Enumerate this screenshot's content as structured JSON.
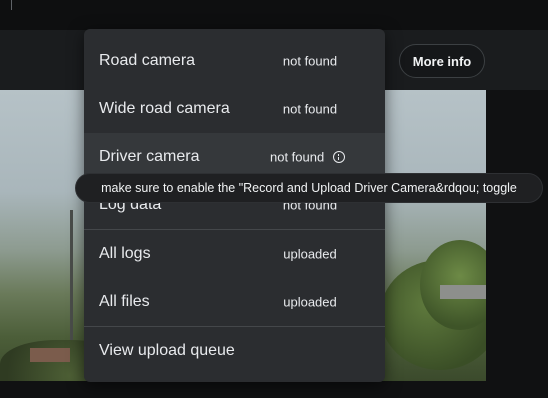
{
  "header": {
    "more_info_label": "More info"
  },
  "menu": {
    "items": [
      {
        "label": "Road camera",
        "status": "not found"
      },
      {
        "label": "Wide road camera",
        "status": "not found"
      },
      {
        "label": "Driver camera",
        "status": "not found",
        "icon": "info-icon"
      },
      {
        "label": "Log data",
        "status": "not found"
      },
      {
        "label": "All logs",
        "status": "uploaded"
      },
      {
        "label": "All files",
        "status": "uploaded"
      },
      {
        "label": "View upload queue"
      }
    ]
  },
  "tooltip": {
    "text": "make sure to enable the \"Record and Upload Driver Camera&rdqou; toggle"
  },
  "colors": {
    "menu_background": "#2b2d30",
    "highlight": "#35383b",
    "page_background": "#101112"
  }
}
